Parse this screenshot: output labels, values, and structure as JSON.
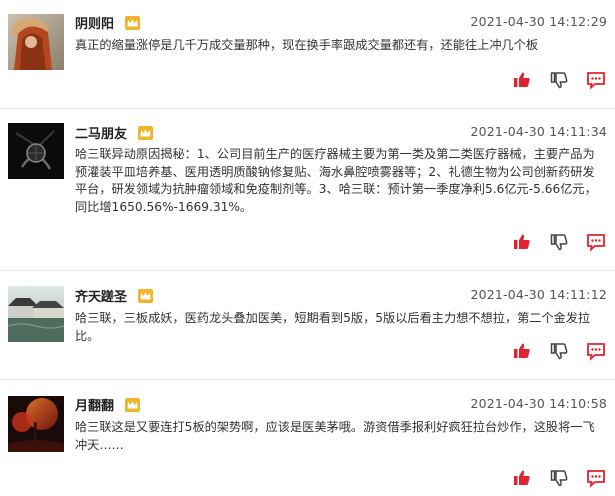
{
  "posts": [
    {
      "username": "阴则阳",
      "time": "2021-04-30 14:12:29",
      "content": "真正的缩量涨停是几千万成交量那种，现在换手率跟成交量都还有，还能往上冲几个板"
    },
    {
      "username": "二马朋友",
      "time": "2021-04-30 14:11:34",
      "content": "哈三联异动原因揭秘：1、公司目前生产的医疗器械主要为第一类及第二类医疗器械，主要产品为预灌装平皿培养基、医用透明质酸钠修复贴、海水鼻腔喷雾器等；2、礼德生物为公司创新药研发平台，研发领域为抗肿瘤领域和免疫制剂等。3、哈三联：预计第一季度净利5.6亿元-5.66亿元，同比增1650.56%-1669.31%。"
    },
    {
      "username": "齐天蹉圣",
      "time": "2021-04-30 14:11:12",
      "content": "哈三联，三板成妖，医药龙头叠加医美，短期看到5版，5版以后看主力想不想拉，第二个金发拉比。"
    },
    {
      "username": "月翻翻",
      "time": "2021-04-30 14:10:58",
      "content": "哈三联这是又要连打5板的架势啊，应该是医美茅哦。游资借季报利好疯狂拉台炒作，这股将一飞冲天……"
    }
  ],
  "colors": {
    "action_red": "#e0232d",
    "vip_gold": "#f0b52a",
    "divider": "#e6e6e6"
  },
  "icons": {
    "like": "thumbs-up-icon",
    "dislike": "thumbs-down-icon",
    "comment": "comment-icon",
    "vip": "vip-crown-icon"
  }
}
